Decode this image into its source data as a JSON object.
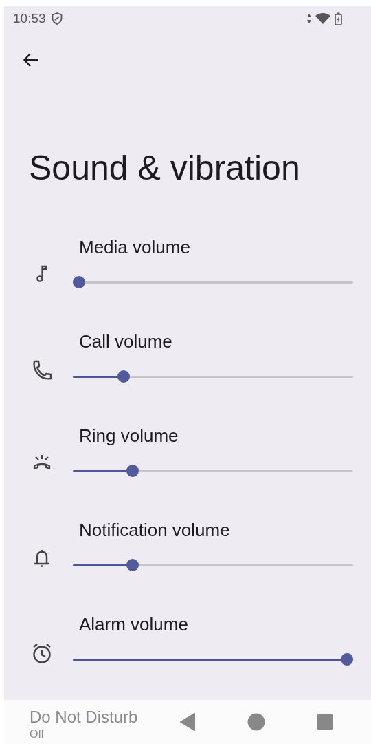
{
  "status_bar": {
    "time": "10:53"
  },
  "title": "Sound & vibration",
  "volumes": [
    {
      "kind": "music",
      "label": "Media volume",
      "level": 0
    },
    {
      "kind": "call",
      "label": "Call volume",
      "level": 0.167
    },
    {
      "kind": "ring",
      "label": "Ring volume",
      "level": 0.2
    },
    {
      "kind": "notification",
      "label": "Notification volume",
      "level": 0.2
    },
    {
      "kind": "alarm",
      "label": "Alarm volume",
      "level": 1
    }
  ],
  "do_not_disturb": {
    "title": "Do Not Disturb",
    "summary": "Off"
  }
}
